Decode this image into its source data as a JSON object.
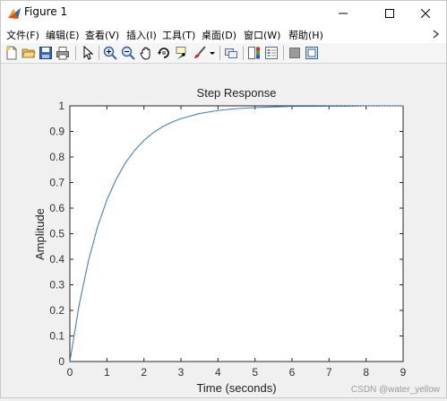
{
  "window": {
    "title": "Figure 1",
    "minimize_label": "",
    "maximize_label": "",
    "close_label": ""
  },
  "menu": {
    "items": [
      "文件(F)",
      "编辑(E)",
      "查看(V)",
      "插入(I)",
      "工具(T)",
      "桌面(D)",
      "窗口(W)",
      "帮助(H)"
    ]
  },
  "toolbar": {
    "buttons": [
      "new-figure-icon",
      "open-file-icon",
      "save-icon",
      "print-icon",
      "pointer-icon",
      "zoom-in-icon",
      "zoom-out-icon",
      "pan-icon",
      "rotate-3d-icon",
      "data-cursor-icon",
      "brush-icon",
      "link-plot-icon",
      "colorbar-icon",
      "legend-icon",
      "hide-plot-tools-icon",
      "show-plot-tools-icon"
    ]
  },
  "watermark": "CSDN @water_yellow",
  "chart_data": {
    "type": "line",
    "title": "Step Response",
    "xlabel": "Time (seconds)",
    "ylabel": "Amplitude",
    "xlim": [
      0,
      9
    ],
    "ylim": [
      0,
      1
    ],
    "xticks": [
      "0",
      "1",
      "2",
      "3",
      "4",
      "5",
      "6",
      "7",
      "8",
      "9"
    ],
    "yticks": [
      "0",
      "0.1",
      "0.2",
      "0.3",
      "0.4",
      "0.5",
      "0.6",
      "0.7",
      "0.8",
      "0.9",
      "1"
    ],
    "grid": false,
    "series": [
      {
        "color": "#4a7fb5",
        "x": [
          0,
          0.25,
          0.5,
          0.75,
          1,
          1.25,
          1.5,
          1.75,
          2,
          2.25,
          2.5,
          2.75,
          3,
          3.5,
          4,
          4.5,
          5,
          5.5,
          6,
          6.5,
          7,
          7.5,
          8,
          8.5,
          9
        ],
        "values": [
          0,
          0.221,
          0.393,
          0.528,
          0.632,
          0.713,
          0.777,
          0.826,
          0.865,
          0.895,
          0.918,
          0.936,
          0.95,
          0.97,
          0.982,
          0.989,
          0.993,
          0.996,
          0.998,
          0.998,
          0.999,
          0.999,
          1.0,
          1.0,
          1.0
        ]
      }
    ]
  }
}
